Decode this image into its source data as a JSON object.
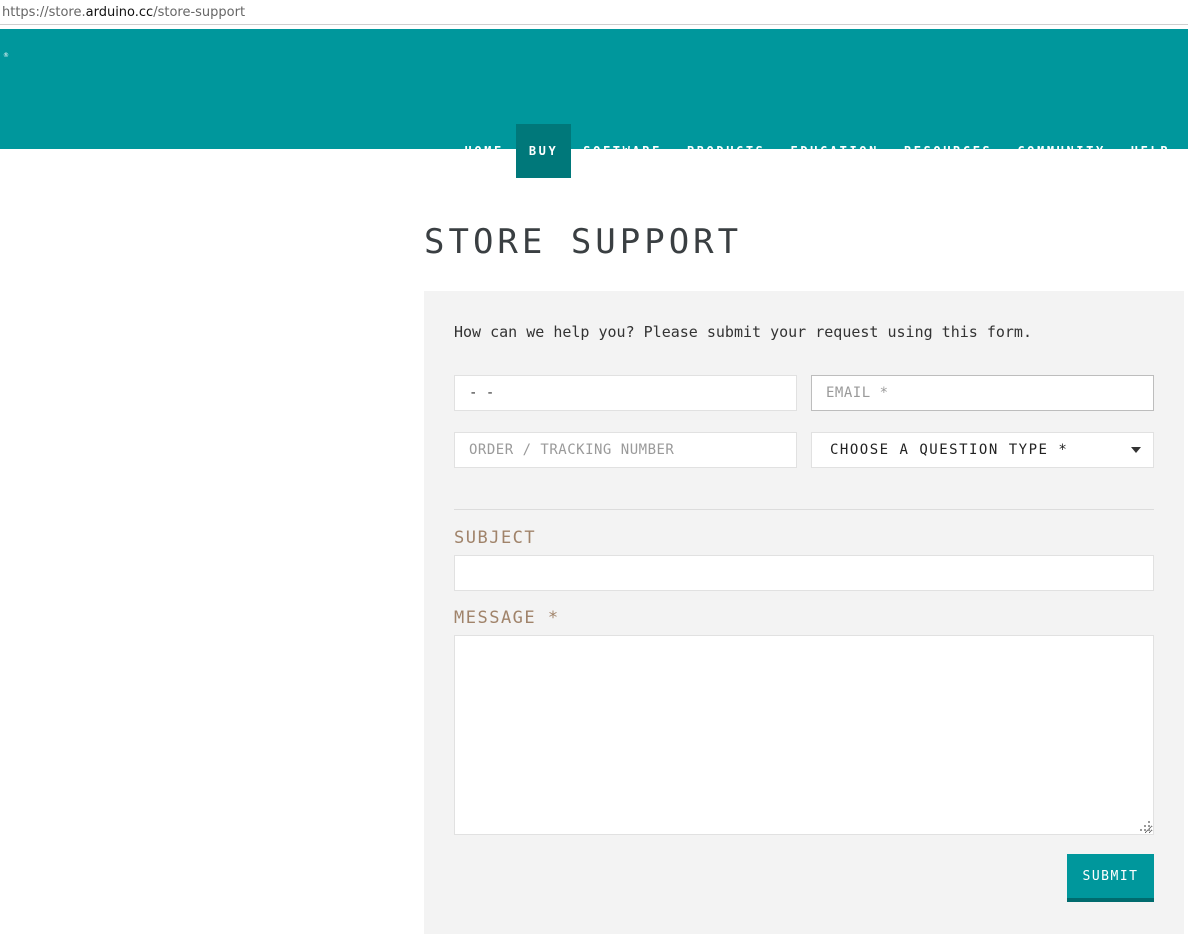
{
  "browser": {
    "url_prefix": "https://store.",
    "url_host": "arduino.cc",
    "url_path": "/store-support"
  },
  "header": {
    "logo_reg": "®",
    "nav": [
      {
        "label": "HOME",
        "active": false
      },
      {
        "label": "BUY",
        "active": true
      },
      {
        "label": "SOFTWARE",
        "active": false
      },
      {
        "label": "PRODUCTS",
        "active": false
      },
      {
        "label": "EDUCATION",
        "active": false
      },
      {
        "label": "RESOURCES",
        "active": false
      },
      {
        "label": "COMMUNITY",
        "active": false
      },
      {
        "label": "HELP",
        "active": false
      }
    ]
  },
  "page": {
    "title": "STORE SUPPORT"
  },
  "form": {
    "intro": "How can we help you? Please submit your request using this form.",
    "name_value": "- -",
    "email_placeholder": "EMAIL *",
    "order_placeholder": "ORDER / TRACKING NUMBER",
    "question_type_selected": "CHOOSE A QUESTION TYPE *",
    "subject_label": "SUBJECT",
    "message_label": "MESSAGE *",
    "submit_label": "SUBMIT"
  },
  "colors": {
    "brand_teal": "#00979c",
    "nav_active": "#00787a",
    "label_brown": "#a0836a",
    "panel_bg": "#f3f3f3"
  }
}
